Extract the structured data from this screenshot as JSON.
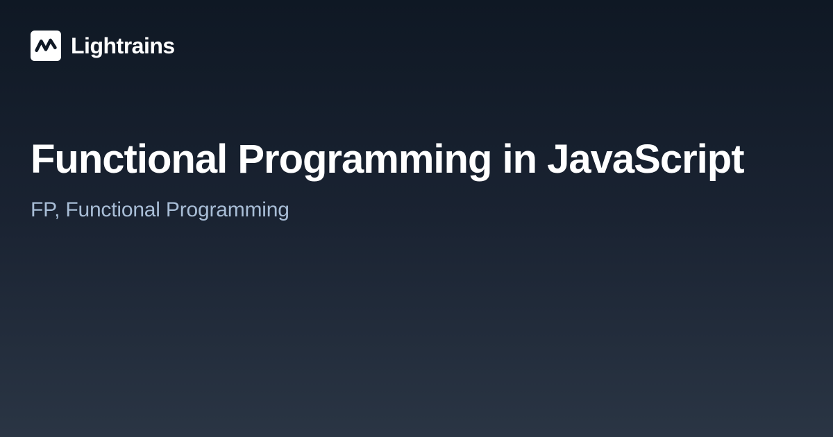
{
  "header": {
    "brand": "Lightrains",
    "logo_icon_name": "chart-zigzag-icon"
  },
  "main": {
    "title": "Functional Programming in JavaScript",
    "subtitle": "FP, Functional Programming"
  }
}
